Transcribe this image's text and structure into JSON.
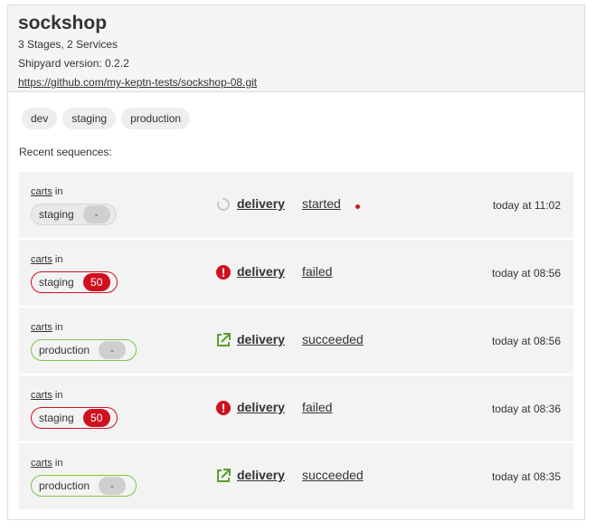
{
  "project": {
    "name": "sockshop",
    "summary": "3 Stages, 2 Services",
    "shipyard_version": "Shipyard version: 0.2.2",
    "repo_url": "https://github.com/my-keptn-tests/sockshop-08.git"
  },
  "stages": [
    "dev",
    "staging",
    "production"
  ],
  "recent_label": "Recent sequences:",
  "in_word": "in",
  "sequences": [
    {
      "service": "carts",
      "stage": "staging",
      "count": "-",
      "stage_state": "neutral",
      "name": "delivery",
      "status": "started",
      "status_icon": "loading-spinner-icon",
      "time": "today at 11:02"
    },
    {
      "service": "carts",
      "stage": "staging",
      "count": "50",
      "stage_state": "error",
      "name": "delivery",
      "status": "failed",
      "status_icon": "error-icon",
      "time": "today at 08:56"
    },
    {
      "service": "carts",
      "stage": "production",
      "count": "-",
      "stage_state": "success",
      "name": "delivery",
      "status": "succeeded",
      "status_icon": "external-link-success-icon",
      "time": "today at 08:56"
    },
    {
      "service": "carts",
      "stage": "staging",
      "count": "50",
      "stage_state": "error",
      "name": "delivery",
      "status": "failed",
      "status_icon": "error-icon",
      "time": "today at 08:36"
    },
    {
      "service": "carts",
      "stage": "production",
      "count": "-",
      "stage_state": "success",
      "name": "delivery",
      "status": "succeeded",
      "status_icon": "external-link-success-icon",
      "time": "today at 08:35"
    }
  ],
  "colors": {
    "error": "#d0101f",
    "success": "#7dc540",
    "spinner": "#c8c8c8"
  }
}
